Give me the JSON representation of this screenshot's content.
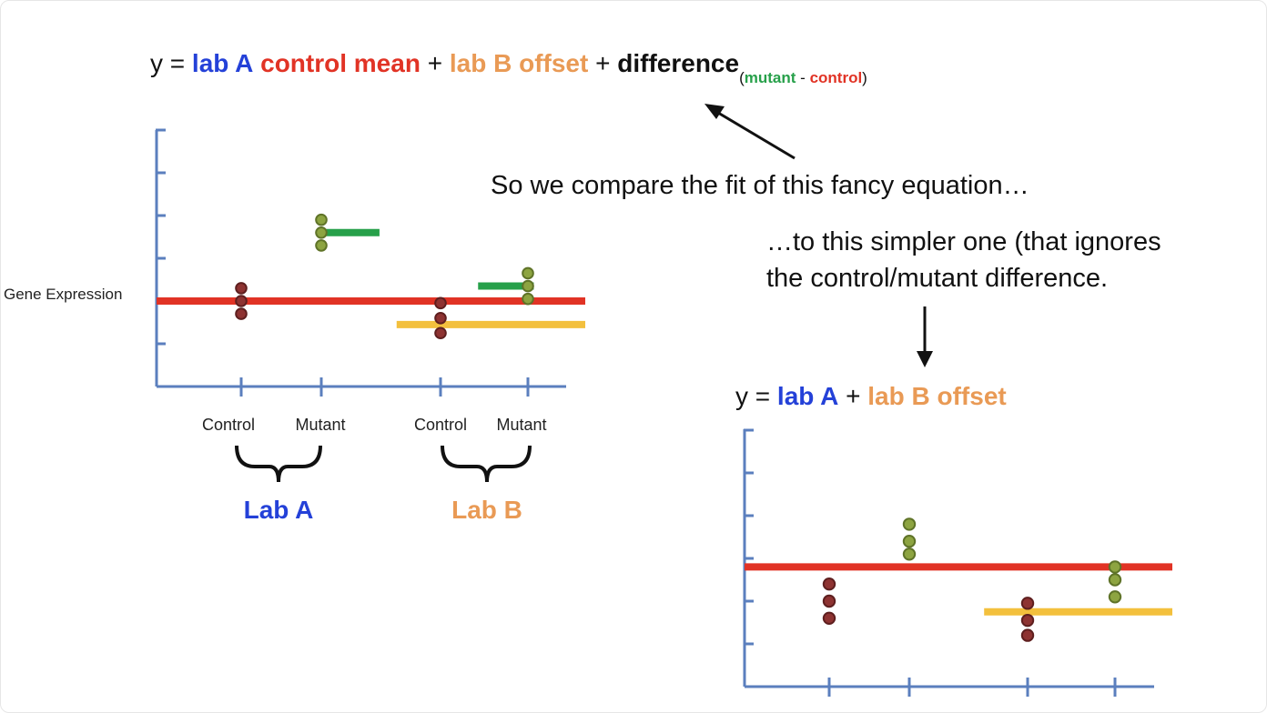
{
  "colors": {
    "lab_a": "#2441d8",
    "control": "#e13325",
    "lab_b": "#e99a55",
    "mutant": "#27a04a",
    "axis": "#5b7fbe",
    "control_dot": "#8e3332",
    "mutant_dot": "#8da441",
    "offset_line": "#f3c03d",
    "text": "#111111"
  },
  "equation_full": {
    "y": "y =",
    "lab_a": "lab A",
    "control_mean": "control mean",
    "plus1": "+",
    "lab_b_offset": "lab B offset",
    "plus2": "+",
    "difference": "difference",
    "sub_open": "(",
    "sub_mutant": "mutant",
    "sub_minus": "-",
    "sub_control": "control",
    "sub_close": ")"
  },
  "equation_simple": {
    "y": "y =",
    "lab_a": "lab A",
    "plus": "+",
    "lab_b_offset": "lab B offset"
  },
  "notes": {
    "compare": "So we compare the fit of this fancy equation…",
    "simpler_line1": "…to this simpler one (that ignores",
    "simpler_line2": "the control/mutant difference."
  },
  "chart_left": {
    "ylabel": "Gene Expression",
    "groups": [
      "Control",
      "Mutant",
      "Control",
      "Mutant"
    ],
    "labs": [
      "Lab A",
      "Lab B"
    ]
  },
  "chart_data": [
    {
      "type": "scatter",
      "y_ticks": 6,
      "groups": [
        {
          "label": "Control",
          "lab": "Lab A",
          "kind": "control",
          "values": [
            2.3,
            2.0,
            1.7
          ]
        },
        {
          "label": "Mutant",
          "lab": "Lab A",
          "kind": "mutant",
          "values": [
            3.9,
            3.6,
            3.3
          ]
        },
        {
          "label": "Control",
          "lab": "Lab B",
          "kind": "control",
          "values": [
            1.95,
            1.6,
            1.25
          ]
        },
        {
          "label": "Mutant",
          "lab": "Lab B",
          "kind": "mutant",
          "values": [
            2.65,
            2.35,
            2.05
          ]
        }
      ],
      "fit_lines": [
        {
          "name": "lab A control mean",
          "color": "control",
          "y": 2.0,
          "from": 0.0,
          "to": 1.0
        },
        {
          "name": "lab A difference",
          "color": "mutant",
          "y": 3.6,
          "from": 0.39,
          "to": 0.52
        },
        {
          "name": "lab B offset",
          "color": "offset_line",
          "y": 1.45,
          "from": 0.56,
          "to": 1.0
        },
        {
          "name": "lab B difference",
          "color": "mutant",
          "y": 2.35,
          "from": 0.75,
          "to": 0.88
        }
      ]
    },
    {
      "type": "scatter",
      "y_ticks": 6,
      "groups": [
        {
          "kind": "control",
          "values": [
            2.4,
            2.0,
            1.6
          ]
        },
        {
          "kind": "mutant",
          "values": [
            3.8,
            3.4,
            3.1
          ]
        },
        {
          "kind": "control",
          "values": [
            1.95,
            1.55,
            1.2
          ]
        },
        {
          "kind": "mutant",
          "values": [
            2.8,
            2.5,
            2.1
          ]
        }
      ],
      "fit_lines": [
        {
          "name": "lab A",
          "color": "control",
          "y": 2.8,
          "from": 0.0,
          "to": 1.0
        },
        {
          "name": "lab B offset",
          "color": "offset_line",
          "y": 1.75,
          "from": 0.56,
          "to": 1.0
        }
      ]
    }
  ]
}
